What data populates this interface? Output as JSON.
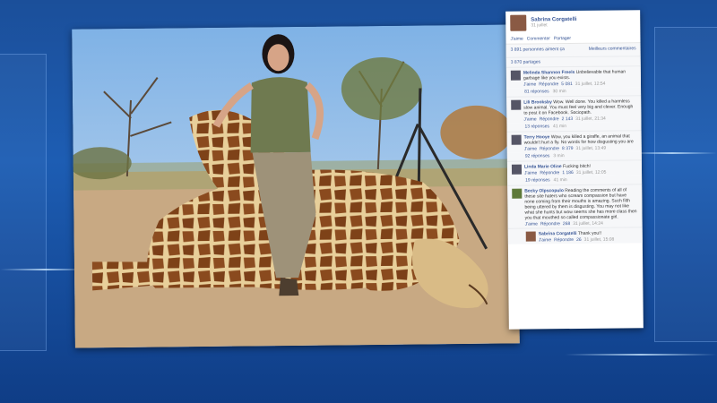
{
  "post": {
    "author": "Sabrina Corgatelli",
    "date": "31 juillet",
    "actions": [
      "J'aime",
      "Commenter",
      "Partager"
    ],
    "likes_text": "3 891 personnes aiment ça",
    "top_comments": "Meilleurs commentaires",
    "shares_text": "3 870 partages"
  },
  "comments": [
    {
      "author": "Melinda Shannon Freels",
      "text": "Unbelievable that human garbage like you exists.",
      "like": "J'aime",
      "reply": "Répondre",
      "count": "5 081",
      "time": "31 juillet, 12:54",
      "replies": "81 réponses",
      "replies_time": "30 min"
    },
    {
      "author": "Lili Brooksby",
      "text": "Wow. Well done. You killed a harmless slow animal. You must feel very big and clever. Enough to post it on Facebook. Sociopath.",
      "like": "J'aime",
      "reply": "Répondre",
      "count": "2 143",
      "time": "31 juillet, 21:34",
      "replies": "13 réponses",
      "replies_time": "41 min"
    },
    {
      "author": "Terry Hooye",
      "text": "Wow, you killed a giraffe, an animal that wouldn't hurt a fly. No words for how disgusting you are",
      "like": "J'aime",
      "reply": "Répondre",
      "count": "8 379",
      "time": "31 juillet, 13:49",
      "replies": "92 réponses",
      "replies_time": "3 min"
    },
    {
      "author": "Linda Marie Oline",
      "text": "Fucking bitch!",
      "like": "J'aime",
      "reply": "Répondre",
      "count": "1 186",
      "time": "31 juillet, 12:05",
      "replies": "19 réponses",
      "replies_time": "41 min"
    },
    {
      "author": "Becky Olpscopulo",
      "text": "Reading the comments of all of these site haters who scream compassion but have none coming from their mouths is amazing. Such filth being uttered by them is disgusting. You may not like what she hunts but wow seems she has more class then you that mouthed so called compassionate girl.",
      "like": "J'aime",
      "reply": "Répondre",
      "count": "268",
      "time": "31 juillet, 14:24",
      "replies": "",
      "replies_time": ""
    },
    {
      "author": "Sabrina Corgatelli",
      "text": "Thank you!!",
      "like": "J'aime",
      "reply": "Répondre",
      "count": "26",
      "time": "31 juillet, 15:08",
      "replies": "",
      "replies_time": ""
    }
  ]
}
